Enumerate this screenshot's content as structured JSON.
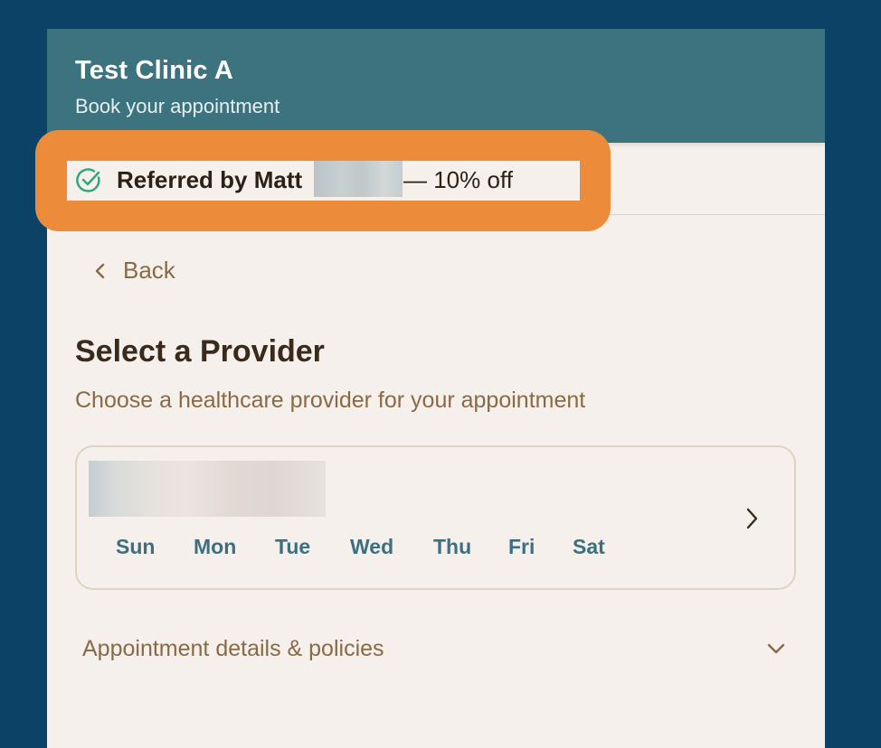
{
  "header": {
    "clinic_name": "Test Clinic A",
    "subtitle": "Book your appointment"
  },
  "referral": {
    "prefix": "Referred by Matt",
    "discount": "— 10% off",
    "icon": "check-circle-icon"
  },
  "nav": {
    "back_label": "Back"
  },
  "main": {
    "title": "Select a Provider",
    "subtitle": "Choose a healthcare provider for your appointment"
  },
  "provider_card": {
    "days": [
      "Sun",
      "Mon",
      "Tue",
      "Wed",
      "Thu",
      "Fri",
      "Sat"
    ]
  },
  "details": {
    "label": "Appointment details & policies"
  },
  "colors": {
    "background": "#0b4266",
    "header": "#3c737e",
    "panel": "#f5f0eb",
    "highlight": "#ec8b3a",
    "accent_text": "#8a6a45",
    "day_text": "#3c6f80",
    "check_green": "#2fa37a"
  }
}
